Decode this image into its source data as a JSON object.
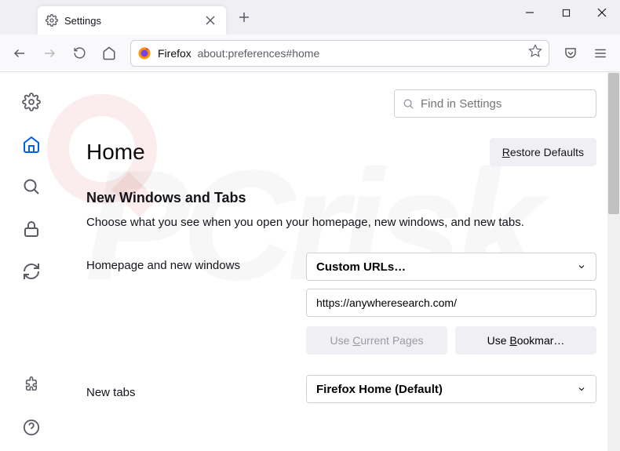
{
  "window": {
    "tab_title": "Settings",
    "urlbar_product": "Firefox",
    "urlbar_path": "about:preferences#home"
  },
  "search": {
    "placeholder": "Find in Settings"
  },
  "page": {
    "title": "Home",
    "restore_button": "Restore Defaults"
  },
  "section": {
    "heading": "New Windows and Tabs",
    "description": "Choose what you see when you open your homepage, new windows, and new tabs."
  },
  "homepage": {
    "label": "Homepage and new windows",
    "select_value": "Custom URLs…",
    "url_value": "https://anywheresearch.com/",
    "use_current": "Use Current Pages",
    "use_bookmark": "Use Bookmar…"
  },
  "newtabs": {
    "label": "New tabs",
    "select_value": "Firefox Home (Default)"
  }
}
